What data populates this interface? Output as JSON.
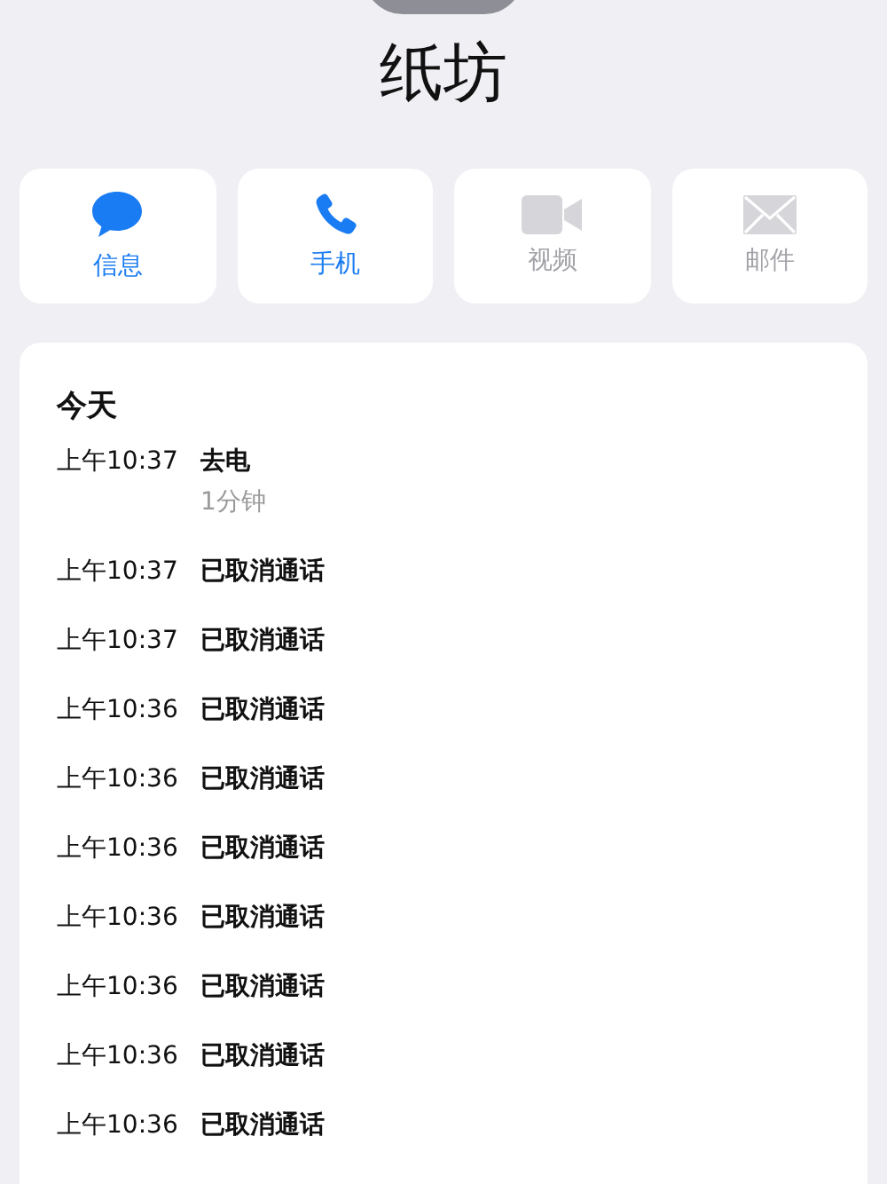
{
  "contact": {
    "name": "纸坊"
  },
  "actions": [
    {
      "kind": "message",
      "label": "信息",
      "disabled": false
    },
    {
      "kind": "phone",
      "label": "手机",
      "disabled": false
    },
    {
      "kind": "video",
      "label": "视频",
      "disabled": true
    },
    {
      "kind": "mail",
      "label": "邮件",
      "disabled": true
    }
  ],
  "call_history": {
    "heading": "今天",
    "rows": [
      {
        "time": "上午10:37",
        "type": "去电",
        "duration": "1分钟"
      },
      {
        "time": "上午10:37",
        "type": "已取消通话"
      },
      {
        "time": "上午10:37",
        "type": "已取消通话"
      },
      {
        "time": "上午10:36",
        "type": "已取消通话"
      },
      {
        "time": "上午10:36",
        "type": "已取消通话"
      },
      {
        "time": "上午10:36",
        "type": "已取消通话"
      },
      {
        "time": "上午10:36",
        "type": "已取消通话"
      },
      {
        "time": "上午10:36",
        "type": "已取消通话"
      },
      {
        "time": "上午10:36",
        "type": "已取消通话"
      },
      {
        "time": "上午10:36",
        "type": "已取消通话"
      }
    ]
  }
}
